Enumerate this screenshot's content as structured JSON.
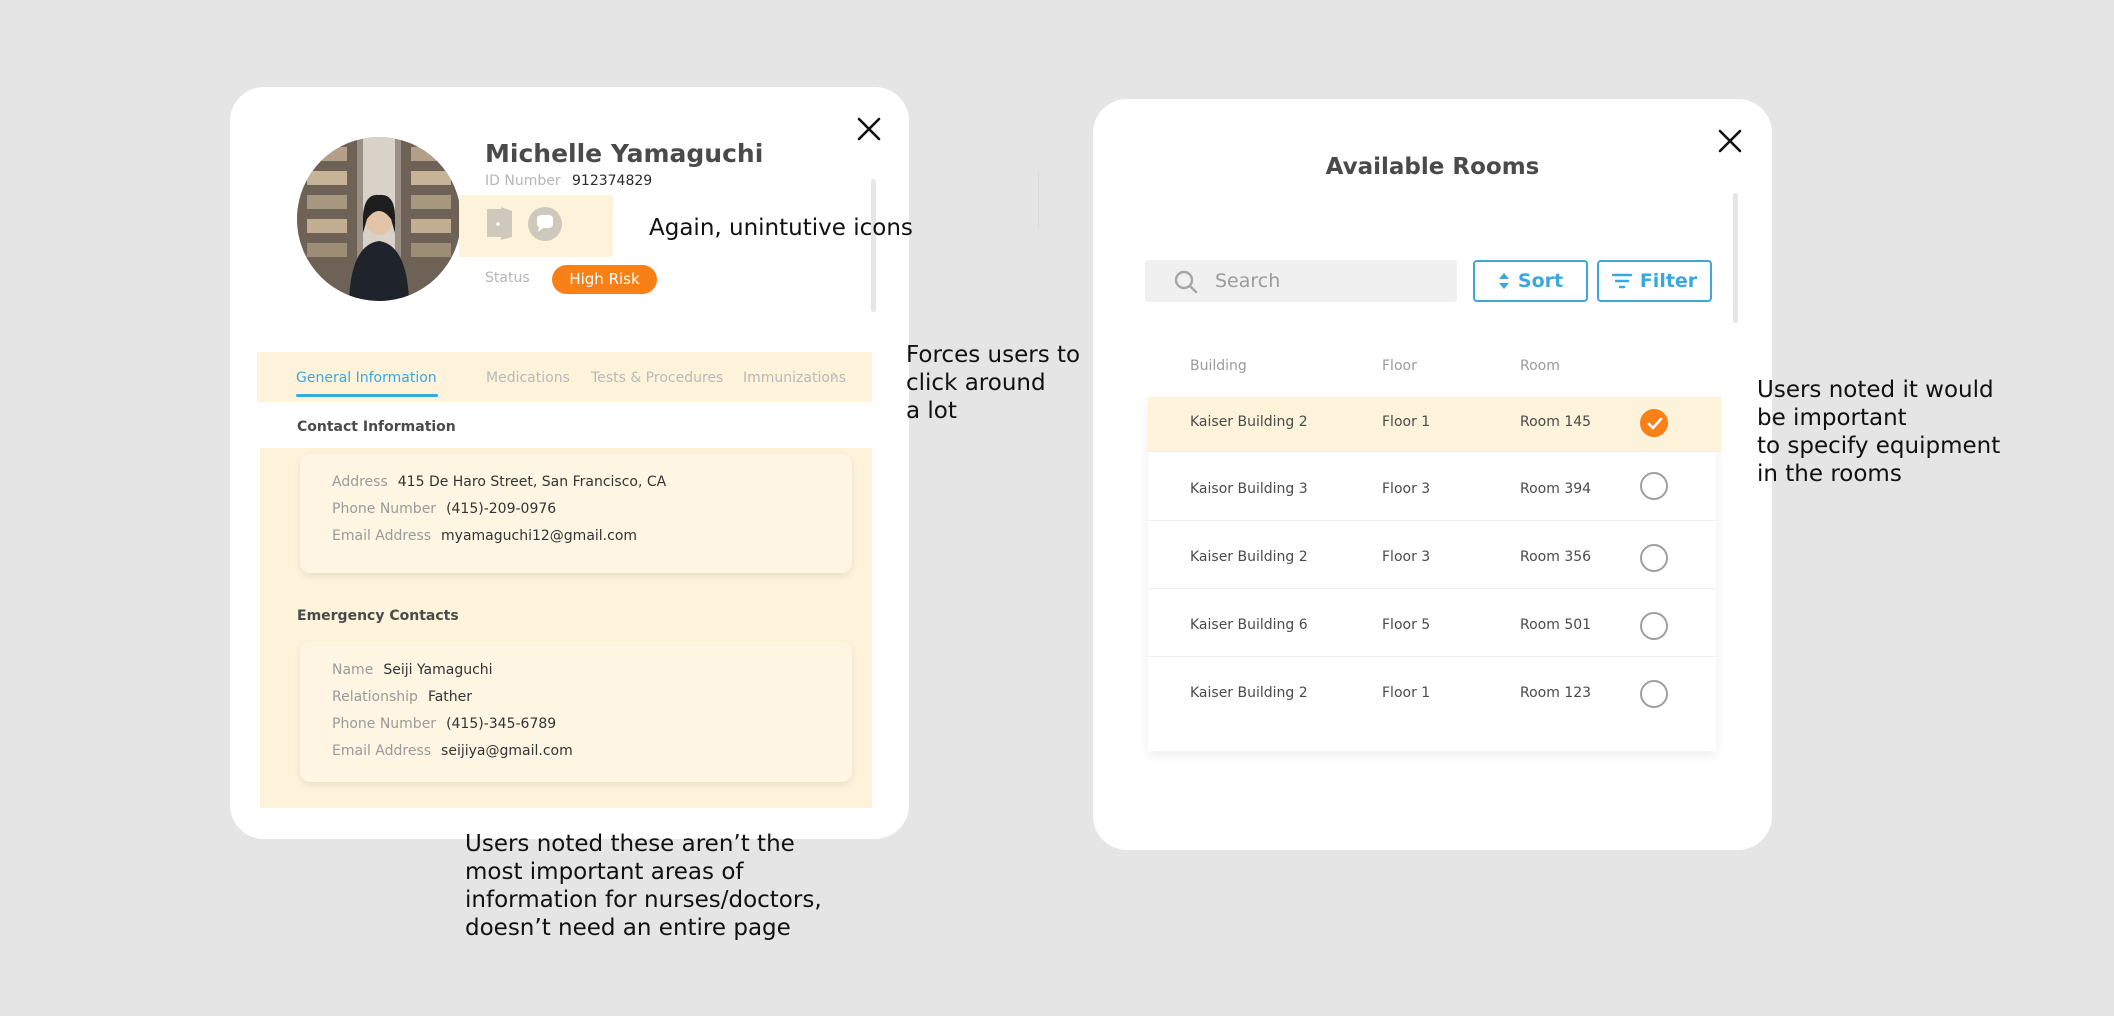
{
  "patient_card": {
    "name": "Michelle Yamaguchi",
    "id_label": "ID Number",
    "id_value": "912374829",
    "status_label": "Status",
    "status_badge": "High Risk",
    "tabs": [
      {
        "label": "General Information",
        "active": true
      },
      {
        "label": "Medications",
        "active": false
      },
      {
        "label": "Tests & Procedures",
        "active": false
      },
      {
        "label": "Immunizations",
        "active": false
      }
    ],
    "contact": {
      "title": "Contact Information",
      "address_label": "Address",
      "address": "415 De Haro Street, San Francisco, CA",
      "phone_label": "Phone Number",
      "phone": "(415)-209-0976",
      "email_label": "Email Address",
      "email": "myamaguchi12@gmail.com"
    },
    "emergency": {
      "title": "Emergency Contacts",
      "name_label": "Name",
      "name": "Seiji Yamaguchi",
      "relationship_label": "Relationship",
      "relationship": "Father",
      "phone_label": "Phone Number",
      "phone": "(415)-345-6789",
      "email_label": "Email Address",
      "email": "seijiya@gmail.com"
    }
  },
  "rooms_card": {
    "title": "Available Rooms",
    "search_placeholder": "Search",
    "sort_label": "Sort",
    "filter_label": "Filter",
    "columns": [
      "Building",
      "Floor",
      "Room"
    ],
    "rows": [
      {
        "building": "Kaiser Building 2",
        "floor": "Floor 1",
        "room": "Room 145",
        "selected": true
      },
      {
        "building": "Kaisor Building 3",
        "floor": "Floor 3",
        "room": "Room 394",
        "selected": false
      },
      {
        "building": "Kaiser Building 2",
        "floor": "Floor 3",
        "room": "Room 356",
        "selected": false
      },
      {
        "building": "Kaiser Building 6",
        "floor": "Floor 5",
        "room": "Room 501",
        "selected": false
      },
      {
        "building": "Kaiser Building 2",
        "floor": "Floor 1",
        "room": "Room 123",
        "selected": false
      }
    ]
  },
  "annotations": {
    "icons_note": "Again, unintutive icons",
    "tabs_note": "Forces users to\nclick around\na lot",
    "info_note": "Users noted these aren’t the\nmost important areas of\ninformation for nurses/doctors,\ndoesn’t need an entire page",
    "rooms_note": "Users noted it would\nbe important\nto specify equipment\nin the rooms"
  },
  "colors": {
    "background": "#e5e5e5",
    "accent_blue": "#3aa8df",
    "accent_orange": "#f98016",
    "highlight_cream": "#fdf3db"
  }
}
